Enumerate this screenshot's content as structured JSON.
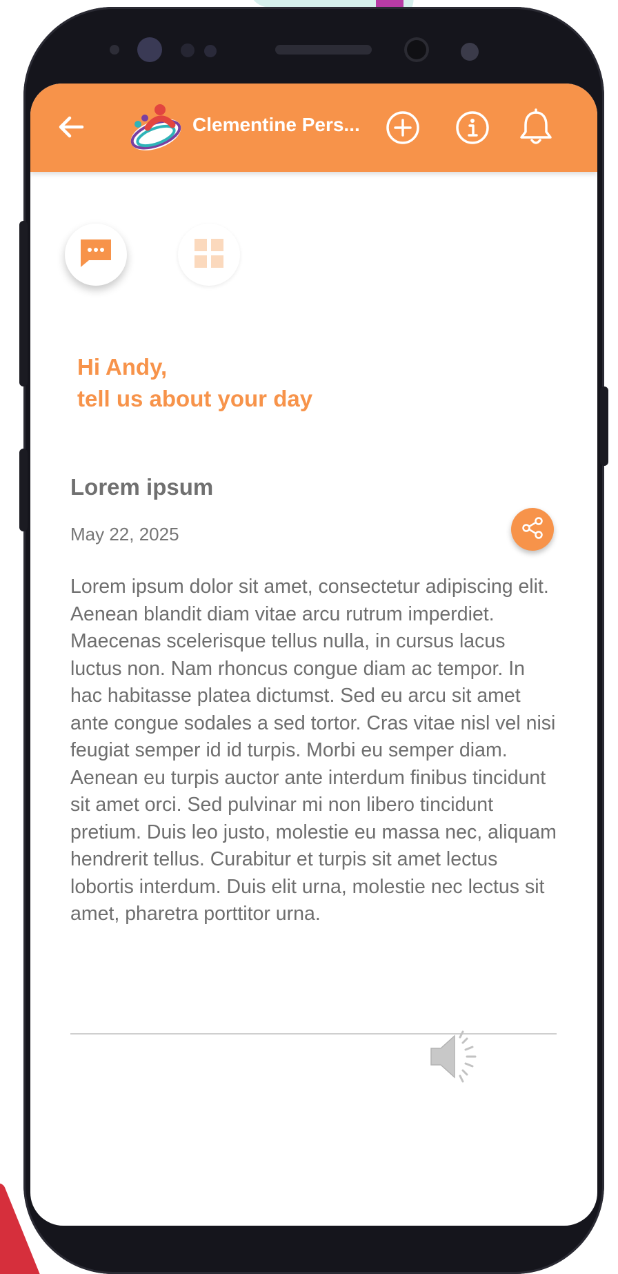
{
  "colors": {
    "accent": "#f7934a",
    "text_muted": "#707070",
    "phone_body": "#15151c"
  },
  "app_bar": {
    "title": "Clementine Pers...",
    "back_icon": "arrow-left-icon",
    "logo_icon": "clementine-logo-icon",
    "add_icon": "plus-circle-icon",
    "info_icon": "info-circle-icon",
    "notifications_icon": "bell-icon"
  },
  "mode_switch": {
    "active": "chat",
    "chat_icon": "chat-bubble-icon",
    "grid_icon": "grid-icon"
  },
  "greeting": {
    "line1": "Hi Andy,",
    "line2": "tell us about your day"
  },
  "entry": {
    "title": "Lorem ipsum",
    "date": "May 22, 2025",
    "share_icon": "share-icon",
    "body": "Lorem ipsum dolor sit amet, consectetur adipiscing elit. Aenean blandit diam vitae arcu rutrum imperdiet. Maecenas scelerisque tellus nulla, in cursus lacus luctus non. Nam rhoncus congue diam ac tempor. In hac habitasse platea dictumst. Sed eu arcu sit amet ante congue sodales a sed tortor. Cras vitae nisl vel nisi feugiat semper id id turpis. Morbi eu semper diam. Aenean eu turpis auctor ante interdum finibus tincidunt sit amet orci. Sed pulvinar mi non libero tincidunt pretium. Duis leo justo, molestie eu massa nec, aliquam hendrerit tellus. Curabitur et turpis sit amet lectus lobortis interdum. Duis elit urna, molestie nec lectus sit amet, pharetra porttitor urna.",
    "audio_icon": "speaker-icon"
  }
}
